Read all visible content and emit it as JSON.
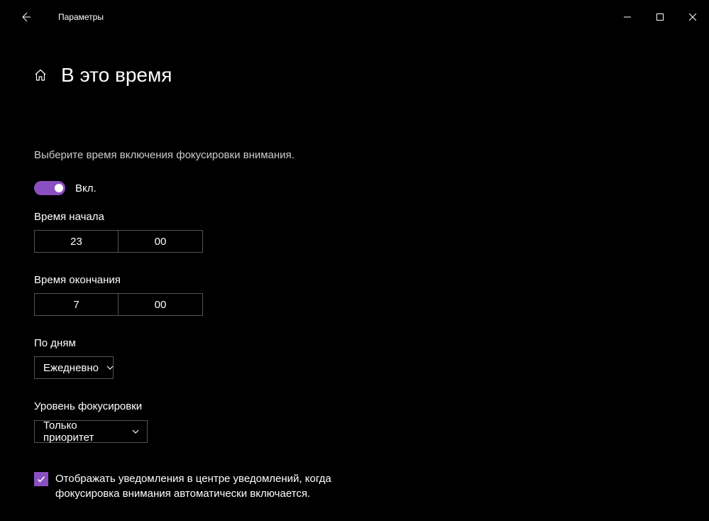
{
  "app_title": "Параметры",
  "page_title": "В это время",
  "description": "Выберите время включения фокусировки внимания.",
  "toggle": {
    "state": "Вкл."
  },
  "start": {
    "label": "Время начала",
    "hour": "23",
    "minute": "00"
  },
  "end": {
    "label": "Время окончания",
    "hour": "7",
    "minute": "00"
  },
  "days": {
    "label": "По дням",
    "value": "Ежедневно"
  },
  "focus": {
    "label": "Уровень фокусировки",
    "value": "Только приоритет"
  },
  "checkbox_text": "Отображать уведомления в центре уведомлений, когда фокусировка внимания автоматически включается."
}
